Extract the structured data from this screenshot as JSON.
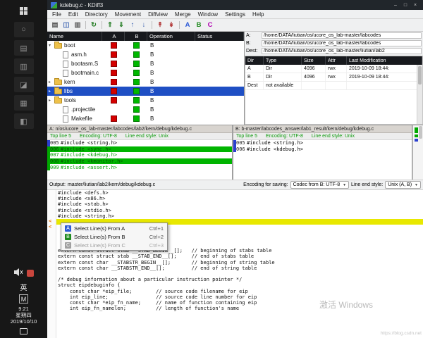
{
  "colors": {
    "selection_blue": "#1f4fc4",
    "diff_green": "#00b400",
    "mark_blue": "#2b3fd0",
    "mark_green": "#00a800",
    "conflict_yellow": "#e8e800",
    "header_dark": "#17191d"
  },
  "taskbar": {
    "apps": [
      {
        "name": "taskbar-app-1",
        "glyph": "○"
      },
      {
        "name": "taskbar-app-2",
        "glyph": "▤"
      },
      {
        "name": "taskbar-app-3",
        "glyph": "▥"
      },
      {
        "name": "taskbar-app-4",
        "glyph": "◪"
      },
      {
        "name": "taskbar-app-5",
        "glyph": "▦"
      },
      {
        "name": "taskbar-app-6",
        "glyph": "◧"
      }
    ],
    "tray": {
      "ime_lang": "英",
      "ime_mode": "M",
      "time": "9:21",
      "weekday": "星期四",
      "date": "2019/10/10"
    }
  },
  "titlebar": {
    "title": "kdebug.c - KDiff3",
    "controls": [
      {
        "name": "minimize-button",
        "glyph": "–"
      },
      {
        "name": "maximize-button",
        "glyph": "□"
      },
      {
        "name": "close-button",
        "glyph": "×"
      }
    ]
  },
  "menubar": {
    "items": [
      "File",
      "Edit",
      "Directory",
      "Movement",
      "Diffview",
      "Merge",
      "Window",
      "Settings",
      "Help"
    ]
  },
  "toolbar": {
    "icons": [
      {
        "name": "open-file-icon",
        "glyph": "▤",
        "color": "#5b5b5b"
      },
      {
        "name": "save-icon",
        "glyph": "◫",
        "color": "#3a62b0"
      },
      {
        "name": "print-icon",
        "glyph": "▥",
        "color": "#5b5b5b"
      },
      {
        "type": "sep"
      },
      {
        "name": "reload-icon",
        "glyph": "↻",
        "color": "#1f7a1f"
      },
      {
        "type": "sep"
      },
      {
        "name": "go-prev-delta-icon",
        "glyph": "⇑",
        "color": "#1f7a1f"
      },
      {
        "name": "go-next-delta-icon",
        "glyph": "⇓",
        "color": "#1f7a1f"
      },
      {
        "name": "go-top-icon",
        "glyph": "↑",
        "color": "#3a62b0"
      },
      {
        "name": "go-bottom-icon",
        "glyph": "↓",
        "color": "#3a62b0"
      },
      {
        "type": "sep"
      },
      {
        "name": "prev-unsolved-conflict-icon",
        "glyph": "↟",
        "color": "#b03333"
      },
      {
        "name": "next-unsolved-conflict-icon",
        "glyph": "↡",
        "color": "#b03333"
      },
      {
        "type": "sep"
      },
      {
        "name": "select-a-icon",
        "glyph": "A",
        "color": "#2e5bd7"
      },
      {
        "name": "select-b-icon",
        "glyph": "B",
        "color": "#1f8a1f"
      },
      {
        "name": "select-c-icon",
        "glyph": "C",
        "color": "#b000b0"
      }
    ]
  },
  "dir_tree": {
    "columns": [
      "Name",
      "A",
      "B",
      "Operation",
      "Status"
    ],
    "rows": [
      {
        "name": "boot",
        "kind": "folder",
        "indent": 0,
        "expanded": true,
        "a": "#d40000",
        "b": "#00b800",
        "op": "B",
        "selected": false
      },
      {
        "name": "asm.h",
        "kind": "file",
        "indent": 1,
        "a": "#d40000",
        "b": "#00b800",
        "op": "B",
        "selected": false
      },
      {
        "name": "bootasm.S",
        "kind": "file",
        "indent": 1,
        "a": "#d40000",
        "b": "#00b800",
        "op": "B",
        "selected": false
      },
      {
        "name": "bootmain.c",
        "kind": "file",
        "indent": 1,
        "a": "#d40000",
        "b": "#00b800",
        "op": "B",
        "selected": false
      },
      {
        "name": "kern",
        "kind": "folder",
        "indent": 0,
        "expanded": false,
        "a": "#d40000",
        "b": "#00b800",
        "op": "B",
        "selected": false
      },
      {
        "name": "libs",
        "kind": "folder",
        "indent": 0,
        "expanded": false,
        "a": "#d40000",
        "b": "#00b800",
        "op": "B",
        "selected": true
      },
      {
        "name": "tools",
        "kind": "folder",
        "indent": 0,
        "expanded": false,
        "a": "#d40000",
        "b": "#00b800",
        "op": "B",
        "selected": false
      },
      {
        "name": ".projectile",
        "kind": "file",
        "indent": 1,
        "a": "",
        "b": "#00b800",
        "op": "B",
        "selected": false
      },
      {
        "name": "Makefile",
        "kind": "file",
        "indent": 1,
        "a": "#d40000",
        "b": "#00b800",
        "op": "B",
        "selected": false
      }
    ]
  },
  "dir_info": {
    "a_label": "A:",
    "a_path": "/home/DATA/liutian/os/ucore_os_lab-master/labcodes",
    "b_label": "B:",
    "b_path": "/home/DATA/liutian/os/ucore_os_lab-master/labcodes",
    "dest_label": "Dest:",
    "dest_path": "/home/DATA/liutian/os/ucore_os_lab-master/liutian/lab2",
    "columns": [
      "Dir",
      "Type",
      "Size",
      "Attr",
      "Last Modification"
    ],
    "rows": [
      [
        "A",
        "Dir",
        "4096",
        "rwx",
        "2019-10-09 18:44:"
      ],
      [
        "B",
        "Dir",
        "4096",
        "rwx",
        "2019-10-09 18:44:"
      ],
      [
        "Dest",
        "not available",
        "",
        "",
        ""
      ]
    ]
  },
  "pane_a": {
    "title": "A: n/os/ucore_os_lab-master/labcodes/lab2/kern/debug/kdebug.c",
    "top_line": "Top line 5",
    "encoding": "Encoding: UTF-8",
    "line_end": "Line end style: Unix",
    "lines": [
      {
        "num": "005",
        "text": "#include <string.h>",
        "kind": "normal",
        "mark": "#2b3fd0"
      },
      {
        "num": "006",
        "text": "#include <sync.h>",
        "kind": "solid",
        "mark": "#00a800"
      },
      {
        "num": "007",
        "text": "#include <kdebug.h>",
        "kind": "added",
        "mark": "#00a800"
      },
      {
        "num": "008",
        "text": "#include <kmonitor.h>",
        "kind": "solid",
        "mark": "#00a800"
      },
      {
        "num": "009",
        "text": "#include <assert.h>",
        "kind": "added",
        "mark": "#00a800"
      }
    ]
  },
  "pane_b": {
    "title": "B: b-master/labcodes_answer/lab1_result/kern/debug/kdebug.c",
    "top_line": "Top line 5",
    "encoding": "Encoding: UTF-8",
    "line_end": "Line end style: Unix",
    "lines": [
      {
        "num": "005",
        "text": "#include <string.h>",
        "kind": "normal",
        "mark": "#2b3fd0"
      },
      {
        "num": "006",
        "text": "#include <kdebug.h>",
        "kind": "normal",
        "mark": "#2b3fd0"
      }
    ]
  },
  "output": {
    "label": "Output:",
    "path": "master/liutian/lab2/kern/debug/kdebug.c",
    "encoding_label": "Encoding for saving:",
    "encoding_value": "Codec from B: UTF-8",
    "line_end_label": "Line end style:",
    "line_end_value": "Unix (A, B)",
    "lines_top": [
      "#include <defs.h>",
      "#include <x86.h>",
      "#include <stab.h>",
      "#include <stdio.h>",
      "#include <string.h>"
    ],
    "lines_bottom": [
      "extern const struct stab __STAB_BEGIN__[];   // beginning of stabs table",
      "extern const struct stab __STAB_END__[];     // end of stabs table",
      "extern const char __STABSTR_BEGIN__[];       // beginning of string table",
      "extern const char __STABSTR_END__[];         // end of string table",
      "",
      "/* debug information about a particular instruction pointer */",
      "struct eipdebuginfo {",
      "    const char *eip_file;        // source code filename for eip",
      "    int eip_line;                // source code line number for eip",
      "    const char *eip_fn_name;     // name of function containing eip",
      "    int eip_fn_namelen;          // length of function's name"
    ]
  },
  "context_menu": {
    "items": [
      {
        "badge": "A",
        "label": "Select Line(s) From A",
        "shortcut": "Ctrl+1",
        "enabled": true,
        "color": "#2e5bd7"
      },
      {
        "badge": "B",
        "label": "Select Line(s) From B",
        "shortcut": "Ctrl+2",
        "enabled": true,
        "color": "#1f8a1f"
      },
      {
        "badge": "C",
        "label": "Select Line(s) From C",
        "shortcut": "Ctrl+3",
        "enabled": false,
        "color": "#a0a0a0"
      }
    ]
  },
  "watermark": "激活 Windows",
  "footer_url": "https://blog.csdn.net"
}
